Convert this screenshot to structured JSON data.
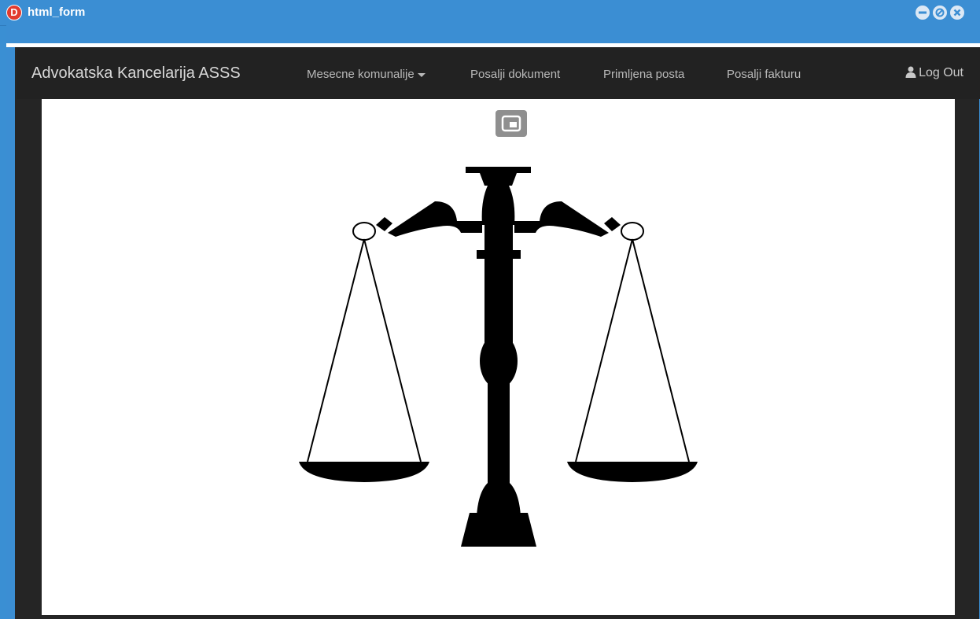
{
  "window": {
    "app_icon_letter": "D",
    "title": "html_form"
  },
  "navbar": {
    "brand": "Advokatska Kancelarija ASSS",
    "items": [
      {
        "label": "Mesecne komunalije",
        "dropdown": true
      },
      {
        "label": "Posalji dokument"
      },
      {
        "label": "Primljena posta"
      },
      {
        "label": "Posalji fakturu"
      }
    ],
    "logout_label": "Log Out"
  },
  "content": {
    "image_icon": "scales-of-justice-icon",
    "overlay_button_icon": "picture-in-picture-icon"
  },
  "colors": {
    "titlebar": "#3b8ed3",
    "navbar": "#222222",
    "content_bg": "#ffffff"
  }
}
